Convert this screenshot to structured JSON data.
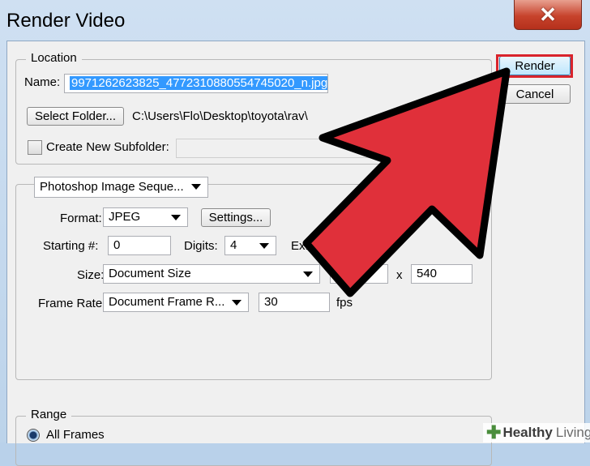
{
  "window": {
    "title": "Render Video",
    "close_glyph": "✕"
  },
  "actions": {
    "render_label": "Render",
    "cancel_label": "Cancel"
  },
  "location": {
    "legend": "Location",
    "name_label": "Name:",
    "name_value": "9971262623825_4772310880554745020_n.jpg",
    "select_folder_label": "Select Folder...",
    "folder_path": "C:\\Users\\Flo\\Desktop\\toyota\\rav\\",
    "subfolder_label": "Create New Subfolder:",
    "subfolder_value": ""
  },
  "export": {
    "exporter_value": "Photoshop Image Seque...",
    "format_label": "Format:",
    "format_value": "JPEG",
    "settings_label": "Settings...",
    "starting_label": "Starting #:",
    "starting_value": "0",
    "digits_label": "Digits:",
    "digits_value": "4",
    "example_label": "Ex: File000",
    "size_label": "Size:",
    "size_value": "Document Size",
    "x_label": "x",
    "height_value": "540",
    "framerate_label": "Frame Rate:",
    "framerate_value": "Document Frame R...",
    "fps_value": "30",
    "fps_label": "fps"
  },
  "range": {
    "legend": "Range",
    "all_frames_label": "All Frames"
  },
  "watermark": {
    "brand_a": "Healthy",
    "brand_b": "Living"
  },
  "icons": [
    "close-icon",
    "chevron-down-icon",
    "red-arrow-pointer",
    "healthy-living-logo"
  ],
  "colors": {
    "accent_red": "#d9242c",
    "selection_blue": "#3399ff"
  }
}
